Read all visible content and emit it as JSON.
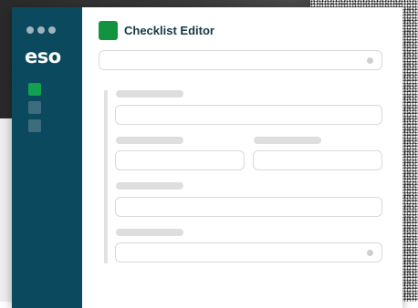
{
  "window": {
    "title": "Checklist Editor"
  },
  "sidebar": {
    "logo": "eso",
    "nav_items": [
      {
        "icon": "checklist-icon",
        "active": true
      },
      {
        "icon": "nav-icon-2",
        "active": false
      },
      {
        "icon": "nav-icon-3",
        "active": false
      }
    ]
  },
  "form": {
    "fields": [
      {
        "label": "",
        "value": ""
      },
      {
        "label": "",
        "value": ""
      },
      {
        "label": "",
        "value": ""
      },
      {
        "label": "",
        "value": ""
      },
      {
        "label": "",
        "value": ""
      }
    ]
  },
  "colors": {
    "sidebar": "#0b4a5e",
    "accent": "#13923f",
    "title": "#143845"
  }
}
